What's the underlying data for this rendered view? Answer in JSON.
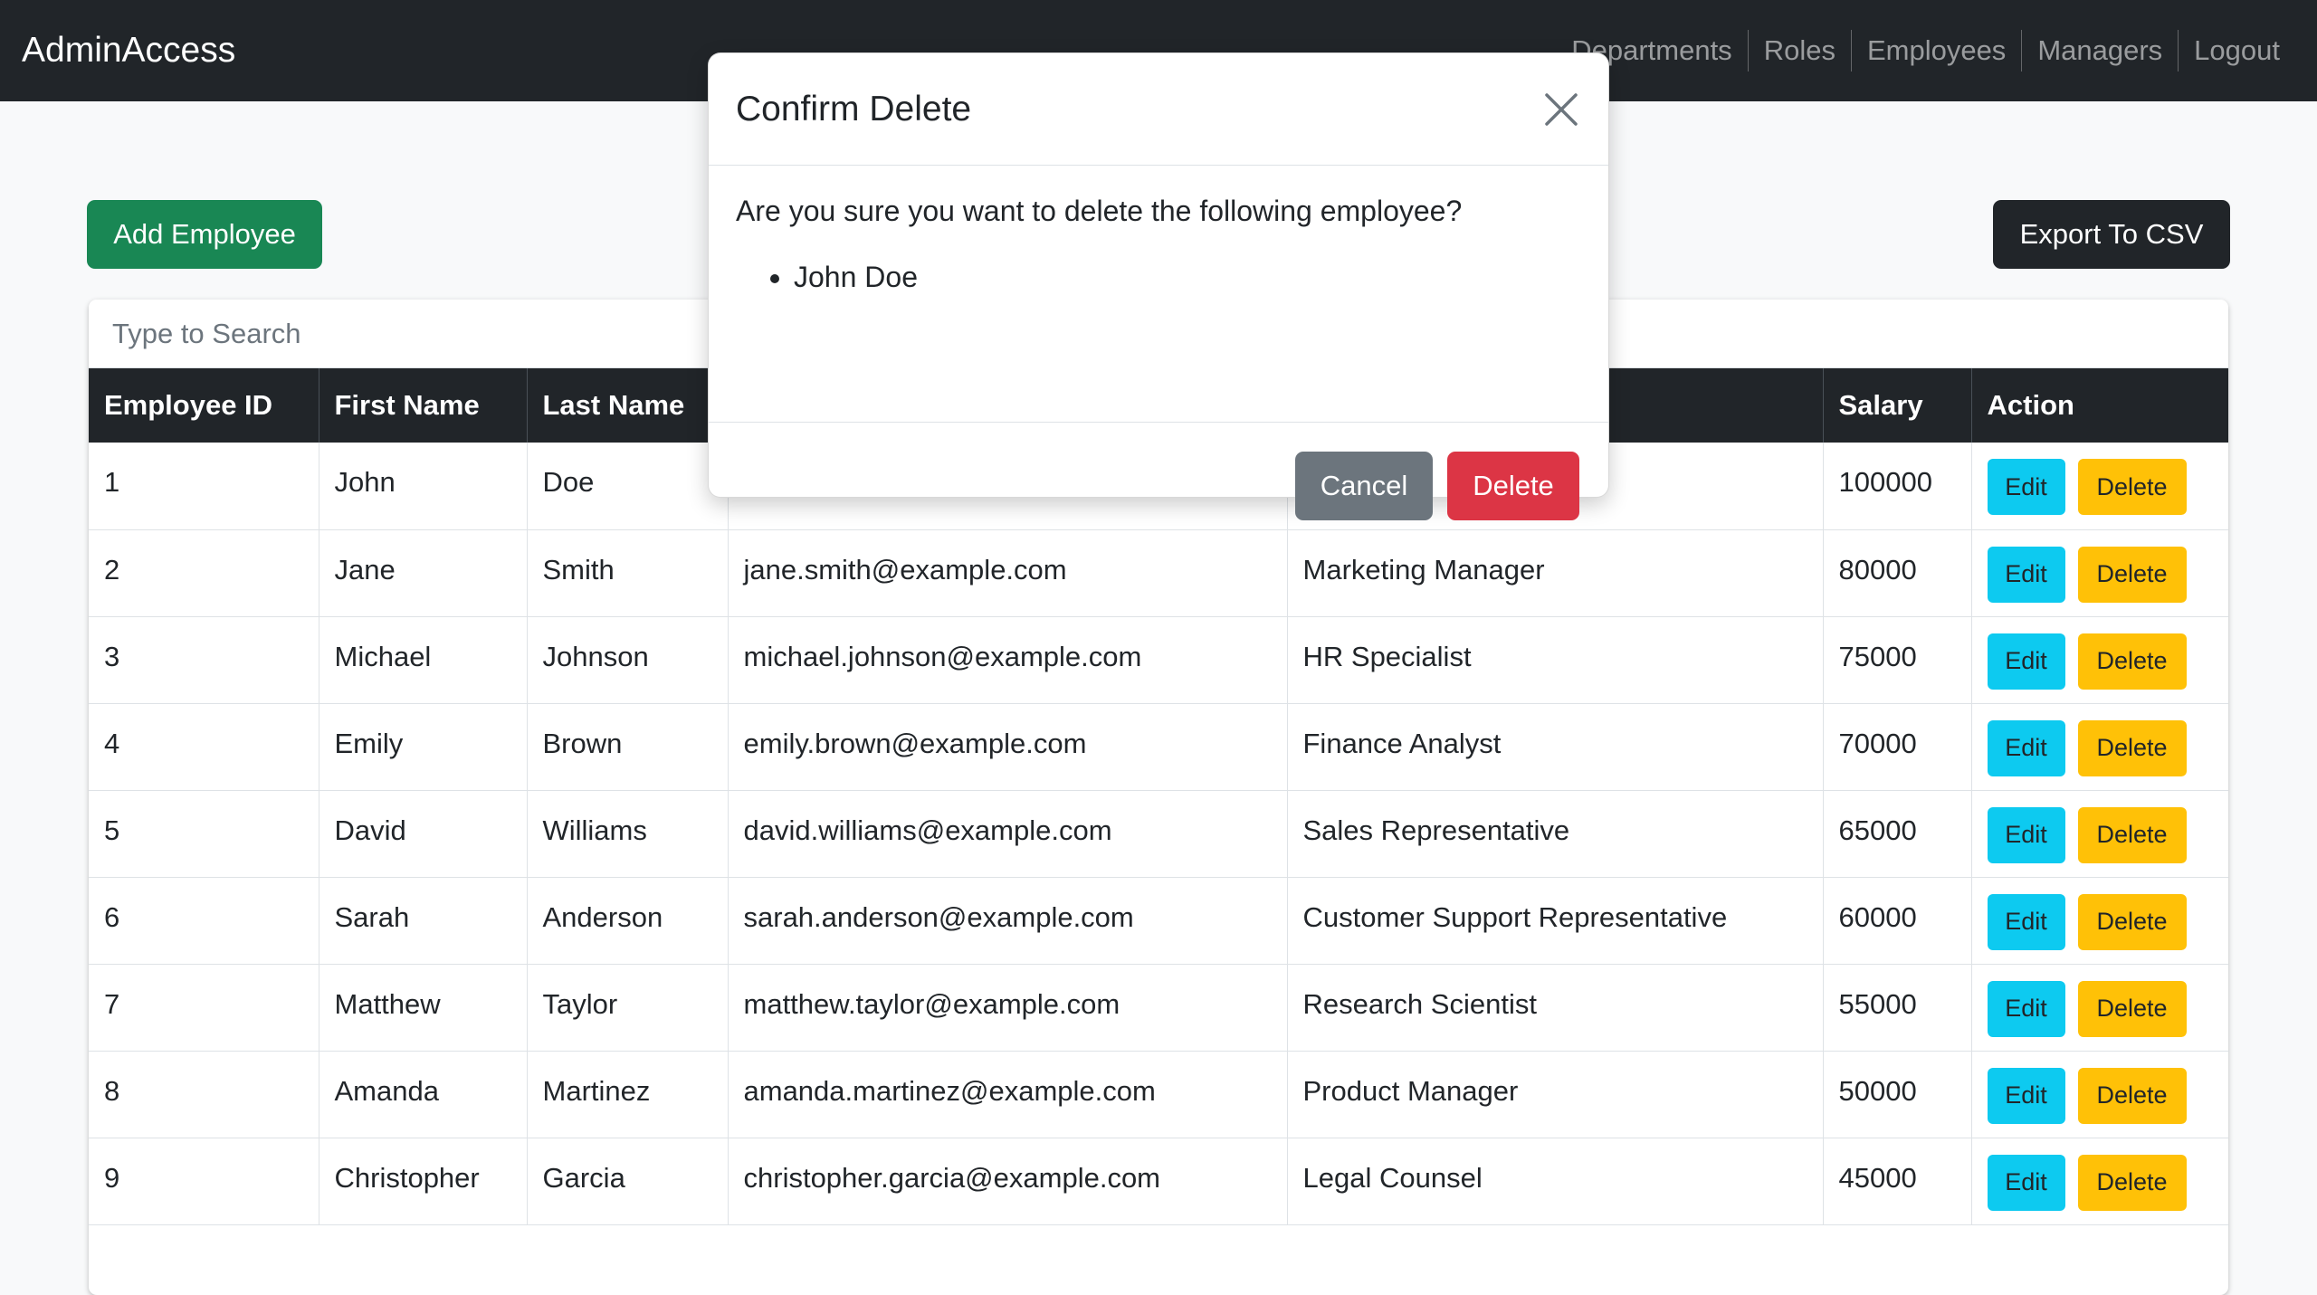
{
  "navbar": {
    "brand": "AdminAccess",
    "links": [
      "Departments",
      "Roles",
      "Employees",
      "Managers",
      "Logout"
    ]
  },
  "toolbar": {
    "add_label": "Add Employee",
    "export_label": "Export To CSV"
  },
  "search": {
    "placeholder": "Type to Search"
  },
  "table": {
    "headers": [
      "Employee ID",
      "First Name",
      "Last Name",
      "",
      "",
      "Salary",
      "Action"
    ],
    "rows": [
      {
        "id": "1",
        "first": "John",
        "last": "Doe",
        "email": "",
        "role": "",
        "salary": "100000"
      },
      {
        "id": "2",
        "first": "Jane",
        "last": "Smith",
        "email": "jane.smith@example.com",
        "role": "Marketing Manager",
        "salary": "80000"
      },
      {
        "id": "3",
        "first": "Michael",
        "last": "Johnson",
        "email": "michael.johnson@example.com",
        "role": "HR Specialist",
        "salary": "75000"
      },
      {
        "id": "4",
        "first": "Emily",
        "last": "Brown",
        "email": "emily.brown@example.com",
        "role": "Finance Analyst",
        "salary": "70000"
      },
      {
        "id": "5",
        "first": "David",
        "last": "Williams",
        "email": "david.williams@example.com",
        "role": "Sales Representative",
        "salary": "65000"
      },
      {
        "id": "6",
        "first": "Sarah",
        "last": "Anderson",
        "email": "sarah.anderson@example.com",
        "role": "Customer Support Representative",
        "salary": "60000"
      },
      {
        "id": "7",
        "first": "Matthew",
        "last": "Taylor",
        "email": "matthew.taylor@example.com",
        "role": "Research Scientist",
        "salary": "55000"
      },
      {
        "id": "8",
        "first": "Amanda",
        "last": "Martinez",
        "email": "amanda.martinez@example.com",
        "role": "Product Manager",
        "salary": "50000"
      },
      {
        "id": "9",
        "first": "Christopher",
        "last": "Garcia",
        "email": "christopher.garcia@example.com",
        "role": "Legal Counsel",
        "salary": "45000"
      }
    ],
    "edit_label": "Edit",
    "delete_label": "Delete"
  },
  "modal": {
    "title": "Confirm Delete",
    "question": "Are you sure you want to delete the following employee?",
    "items": [
      "John Doe"
    ],
    "cancel_label": "Cancel",
    "delete_label": "Delete"
  },
  "colors": {
    "navbar": "#212529",
    "add_button": "#198754",
    "export_button": "#212529",
    "edit_button": "#0dcaf0",
    "row_delete_button": "#ffc107",
    "modal_delete_button": "#dc3545",
    "cancel_button": "#6c757d"
  }
}
